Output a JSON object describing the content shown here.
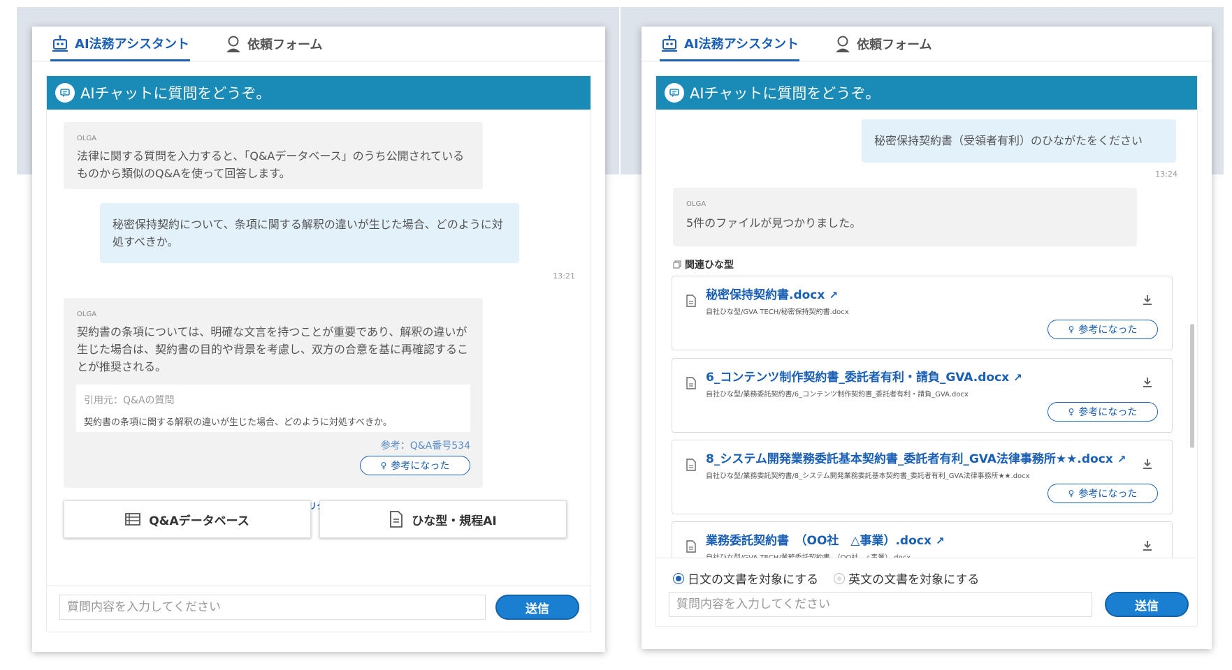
{
  "tabs": {
    "assistant": "AI法務アシスタント",
    "request_form": "依頼フォーム"
  },
  "chat_header": "AIチャットに質問をどうぞ。",
  "left": {
    "intro": {
      "sender": "OLGA",
      "text": "法律に関する質問を入力すると、「Q&Aデータベース」のうち公開されているものから類似のQ&Aを使って回答します。"
    },
    "user_message": {
      "text": "秘密保持契約について、条項に関する解釈の違いが生じた場合、どのように対処すべきか。",
      "time": "13:21"
    },
    "answer": {
      "sender": "OLGA",
      "text": "契約書の条項については、明確な文言を持つことが重要であり、解釈の違いが生じた場合は、契約書の目的や背景を考慮し、双方の合意を基に再確認することが推奨される。",
      "citation_label": "引用元：Q&Aの質問",
      "citation_text": "契約書の条項に関する解釈の違いが生じた場合、どのように対処すべきか。",
      "reference": "参考：Q&A番号534",
      "helpful": "参考になった"
    },
    "another_answer": "別の回答をリクエストする",
    "buttons": {
      "qa_db": "Q&Aデータベース",
      "template_ai": "ひな型・規程AI"
    },
    "input_placeholder": "質問内容を入力してください",
    "send": "送信"
  },
  "right": {
    "user_message": {
      "text": "秘密保持契約書（受領者有利）のひながたをください",
      "time": "13:24"
    },
    "reply": {
      "sender": "OLGA",
      "text": "5件のファイルが見つかりました。"
    },
    "section_title": "関連ひな型",
    "files": [
      {
        "name": "秘密保持契約書.docx",
        "path": "自社ひな型/GVA TECH/秘密保持契約書.docx",
        "helpful": "参考になった"
      },
      {
        "name": "6_コンテンツ制作契約書_委託者有利・請負_GVA.docx",
        "path": "自社ひな型/業務委託契約書/6_コンテンツ制作契約書_委託者有利・請負_GVA.docx",
        "helpful": "参考になった"
      },
      {
        "name": "8_システム開発業務委託基本契約書_委託者有利_GVA法律事務所★★.docx",
        "path": "自社ひな型/業務委託契約書/8_システム開発業務委託基本契約書_委託者有利_GVA法律事務所★★.docx",
        "helpful": "参考になった"
      },
      {
        "name": "業務委託契約書　（OO社　△事業）.docx",
        "path": "自社ひな型/GVA TECH/業務委託契約書　（OO社　△事業）.docx"
      }
    ],
    "radio": {
      "japanese": "日文の文書を対象にする",
      "english": "英文の文書を対象にする"
    },
    "input_placeholder": "質問内容を入力してください",
    "send": "送信"
  },
  "colors": {
    "header": "#1a8ab7",
    "accent": "#1a5fb4",
    "user_bubble": "#e3f1fb",
    "ai_bubble": "#f2f2f2"
  }
}
